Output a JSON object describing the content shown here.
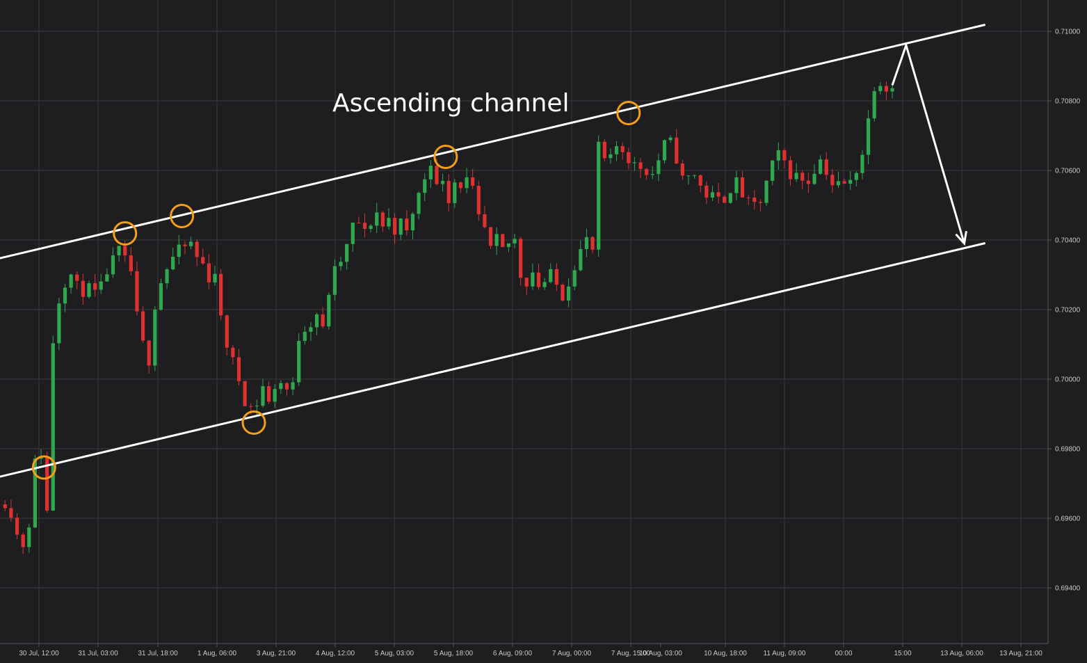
{
  "colors": {
    "background": "#1e1e21",
    "grid": "#3a3a3e",
    "axis_text": "#c9c9c9",
    "bull": "#2fa84f",
    "bear": "#e03131",
    "channel_line": "#ffffff",
    "touch_marker": "#f59f19",
    "arrow": "#ffffff"
  },
  "chart_data": {
    "type": "candlestick",
    "title": "Ascending channel",
    "xlabel": "",
    "ylabel": "",
    "ylim": [
      0.6929,
      0.7109
    ],
    "grid": true,
    "y_axis_position": "right",
    "y_ticks": [
      "0.71000",
      "0.70800",
      "0.70600",
      "0.70400",
      "0.70200",
      "0.70000",
      "0.69800",
      "0.69600",
      "0.69400"
    ],
    "x_ticks": [
      "30 Jul, 12:00",
      "31 Jul, 03:00",
      "31 Jul, 18:00",
      "1 Aug, 06:00",
      "3 Aug, 21:00",
      "4 Aug, 12:00",
      "5 Aug, 03:00",
      "5 Aug, 18:00",
      "6 Aug, 09:00",
      "7 Aug, 00:00",
      "7 Aug, 15:00",
      "10 Aug, 03:00",
      "10 Aug, 18:00",
      "11 Aug, 09:00",
      "00:00",
      "15:00",
      "13 Aug, 06:00",
      "13 Aug, 21:00"
    ],
    "price_path": [
      [
        0,
        0.6964
      ],
      [
        1.5,
        0.6965
      ],
      [
        3.5,
        0.6952
      ],
      [
        4.5,
        0.6953
      ],
      [
        5.3,
        0.6962
      ],
      [
        6.2,
        0.698
      ],
      [
        6.8,
        0.6978
      ],
      [
        7.3,
        0.698
      ],
      [
        8.0,
        0.6962
      ],
      [
        8.7,
        0.7005
      ],
      [
        9.3,
        0.7017
      ],
      [
        10.5,
        0.7027
      ],
      [
        12,
        0.703
      ],
      [
        13.5,
        0.7025
      ],
      [
        15,
        0.7026
      ],
      [
        16.5,
        0.7024
      ],
      [
        18,
        0.7031
      ],
      [
        20,
        0.7037
      ],
      [
        22,
        0.7031
      ],
      [
        23,
        0.7018
      ],
      [
        24,
        0.701
      ],
      [
        24.7,
        0.6998
      ],
      [
        25.5,
        0.7018
      ],
      [
        27,
        0.7028
      ],
      [
        28.5,
        0.7034
      ],
      [
        30,
        0.7037
      ],
      [
        31,
        0.7038
      ],
      [
        32,
        0.7039
      ],
      [
        33,
        0.7035
      ],
      [
        34,
        0.7033
      ],
      [
        35,
        0.7029
      ],
      [
        36,
        0.7031
      ],
      [
        37,
        0.7017
      ],
      [
        38,
        0.701
      ],
      [
        39,
        0.7005
      ],
      [
        40,
        0.7
      ],
      [
        41,
        0.6994
      ],
      [
        42,
        0.6992
      ],
      [
        43,
        0.6993
      ],
      [
        44,
        0.6998
      ],
      [
        45,
        0.6993
      ],
      [
        46,
        0.6998
      ],
      [
        47,
        0.6999
      ],
      [
        48,
        0.6997
      ],
      [
        49,
        0.6998
      ],
      [
        50,
        0.7012
      ],
      [
        51,
        0.7015
      ],
      [
        52,
        0.7016
      ],
      [
        53,
        0.7019
      ],
      [
        54,
        0.7014
      ],
      [
        55,
        0.7025
      ],
      [
        56,
        0.7031
      ],
      [
        57,
        0.7034
      ],
      [
        58,
        0.7038
      ],
      [
        59,
        0.7044
      ],
      [
        60,
        0.7045
      ],
      [
        61,
        0.7042
      ],
      [
        62,
        0.7045
      ],
      [
        63,
        0.7048
      ],
      [
        64,
        0.7044
      ],
      [
        65,
        0.7046
      ],
      [
        66,
        0.7043
      ],
      [
        67,
        0.7045
      ],
      [
        68,
        0.7042
      ],
      [
        69,
        0.7048
      ],
      [
        70,
        0.7053
      ],
      [
        71,
        0.7058
      ],
      [
        72,
        0.7063
      ],
      [
        73,
        0.7055
      ],
      [
        74,
        0.7058
      ],
      [
        75,
        0.7052
      ],
      [
        76,
        0.7057
      ],
      [
        77,
        0.7056
      ],
      [
        78,
        0.7057
      ],
      [
        79,
        0.7054
      ],
      [
        80,
        0.7046
      ],
      [
        81,
        0.7043
      ],
      [
        82,
        0.7037
      ],
      [
        83,
        0.704
      ],
      [
        84,
        0.7037
      ],
      [
        85,
        0.7039
      ],
      [
        86,
        0.704
      ],
      [
        87,
        0.703
      ],
      [
        88,
        0.7028
      ],
      [
        89,
        0.7031
      ],
      [
        90,
        0.7027
      ],
      [
        91,
        0.7028
      ],
      [
        92,
        0.703
      ],
      [
        93,
        0.7027
      ],
      [
        94,
        0.7024
      ],
      [
        95,
        0.7028
      ],
      [
        96,
        0.7033
      ],
      [
        97,
        0.7037
      ],
      [
        98,
        0.704
      ],
      [
        99,
        0.7037
      ],
      [
        99.6,
        0.7067
      ],
      [
        100.5,
        0.7066
      ],
      [
        101.5,
        0.706
      ],
      [
        102.5,
        0.7066
      ],
      [
        103.5,
        0.7068
      ],
      [
        104.5,
        0.7064
      ],
      [
        105.5,
        0.7063
      ],
      [
        106.5,
        0.706
      ],
      [
        107.5,
        0.7062
      ],
      [
        108.5,
        0.7058
      ],
      [
        109.5,
        0.706
      ],
      [
        110.5,
        0.7066
      ],
      [
        111.5,
        0.7069
      ],
      [
        112.5,
        0.7067
      ],
      [
        113.5,
        0.706
      ],
      [
        114.5,
        0.7055
      ],
      [
        115.5,
        0.7061
      ],
      [
        116.5,
        0.7057
      ],
      [
        117.5,
        0.7054
      ],
      [
        118.5,
        0.7052
      ],
      [
        119.5,
        0.7053
      ],
      [
        120.5,
        0.705
      ],
      [
        121.5,
        0.7054
      ],
      [
        122.5,
        0.7056
      ],
      [
        123.5,
        0.7057
      ],
      [
        124.5,
        0.7049
      ],
      [
        125.5,
        0.7052
      ],
      [
        126.5,
        0.7048
      ],
      [
        127.5,
        0.7054
      ],
      [
        128.5,
        0.7059
      ],
      [
        129.5,
        0.7064
      ],
      [
        130.5,
        0.7065
      ],
      [
        131.5,
        0.706
      ],
      [
        132.5,
        0.7058
      ],
      [
        133.5,
        0.7059
      ],
      [
        134.5,
        0.7056
      ],
      [
        135.5,
        0.7058
      ],
      [
        136.5,
        0.7063
      ],
      [
        137.5,
        0.7063
      ],
      [
        138.5,
        0.7057
      ],
      [
        139.5,
        0.7055
      ],
      [
        140.5,
        0.7057
      ],
      [
        141.5,
        0.7055
      ],
      [
        142.5,
        0.7058
      ],
      [
        143.5,
        0.7063
      ],
      [
        144.5,
        0.7067
      ],
      [
        145.5,
        0.7082
      ],
      [
        146.5,
        0.7087
      ],
      [
        147.5,
        0.7084
      ],
      [
        148.5,
        0.7084
      ]
    ],
    "annotations": {
      "channel_upper": {
        "from": [
          -2,
          0.70341
        ],
        "to": [
          164,
          0.71019
        ]
      },
      "channel_lower": {
        "from": [
          -2,
          0.69713
        ],
        "to": [
          164,
          0.70391
        ]
      },
      "touch_points": [
        {
          "x": 7,
          "y": 0.69746
        },
        {
          "x": 20.5,
          "y": 0.70419
        },
        {
          "x": 30,
          "y": 0.70469
        },
        {
          "x": 42,
          "y": 0.69875
        },
        {
          "x": 74,
          "y": 0.70639
        },
        {
          "x": 104.5,
          "y": 0.70765
        }
      ],
      "forecast_arrow": [
        [
          148.5,
          0.70845
        ],
        [
          150.8,
          0.7096
        ],
        [
          160.5,
          0.7039
        ]
      ]
    }
  }
}
